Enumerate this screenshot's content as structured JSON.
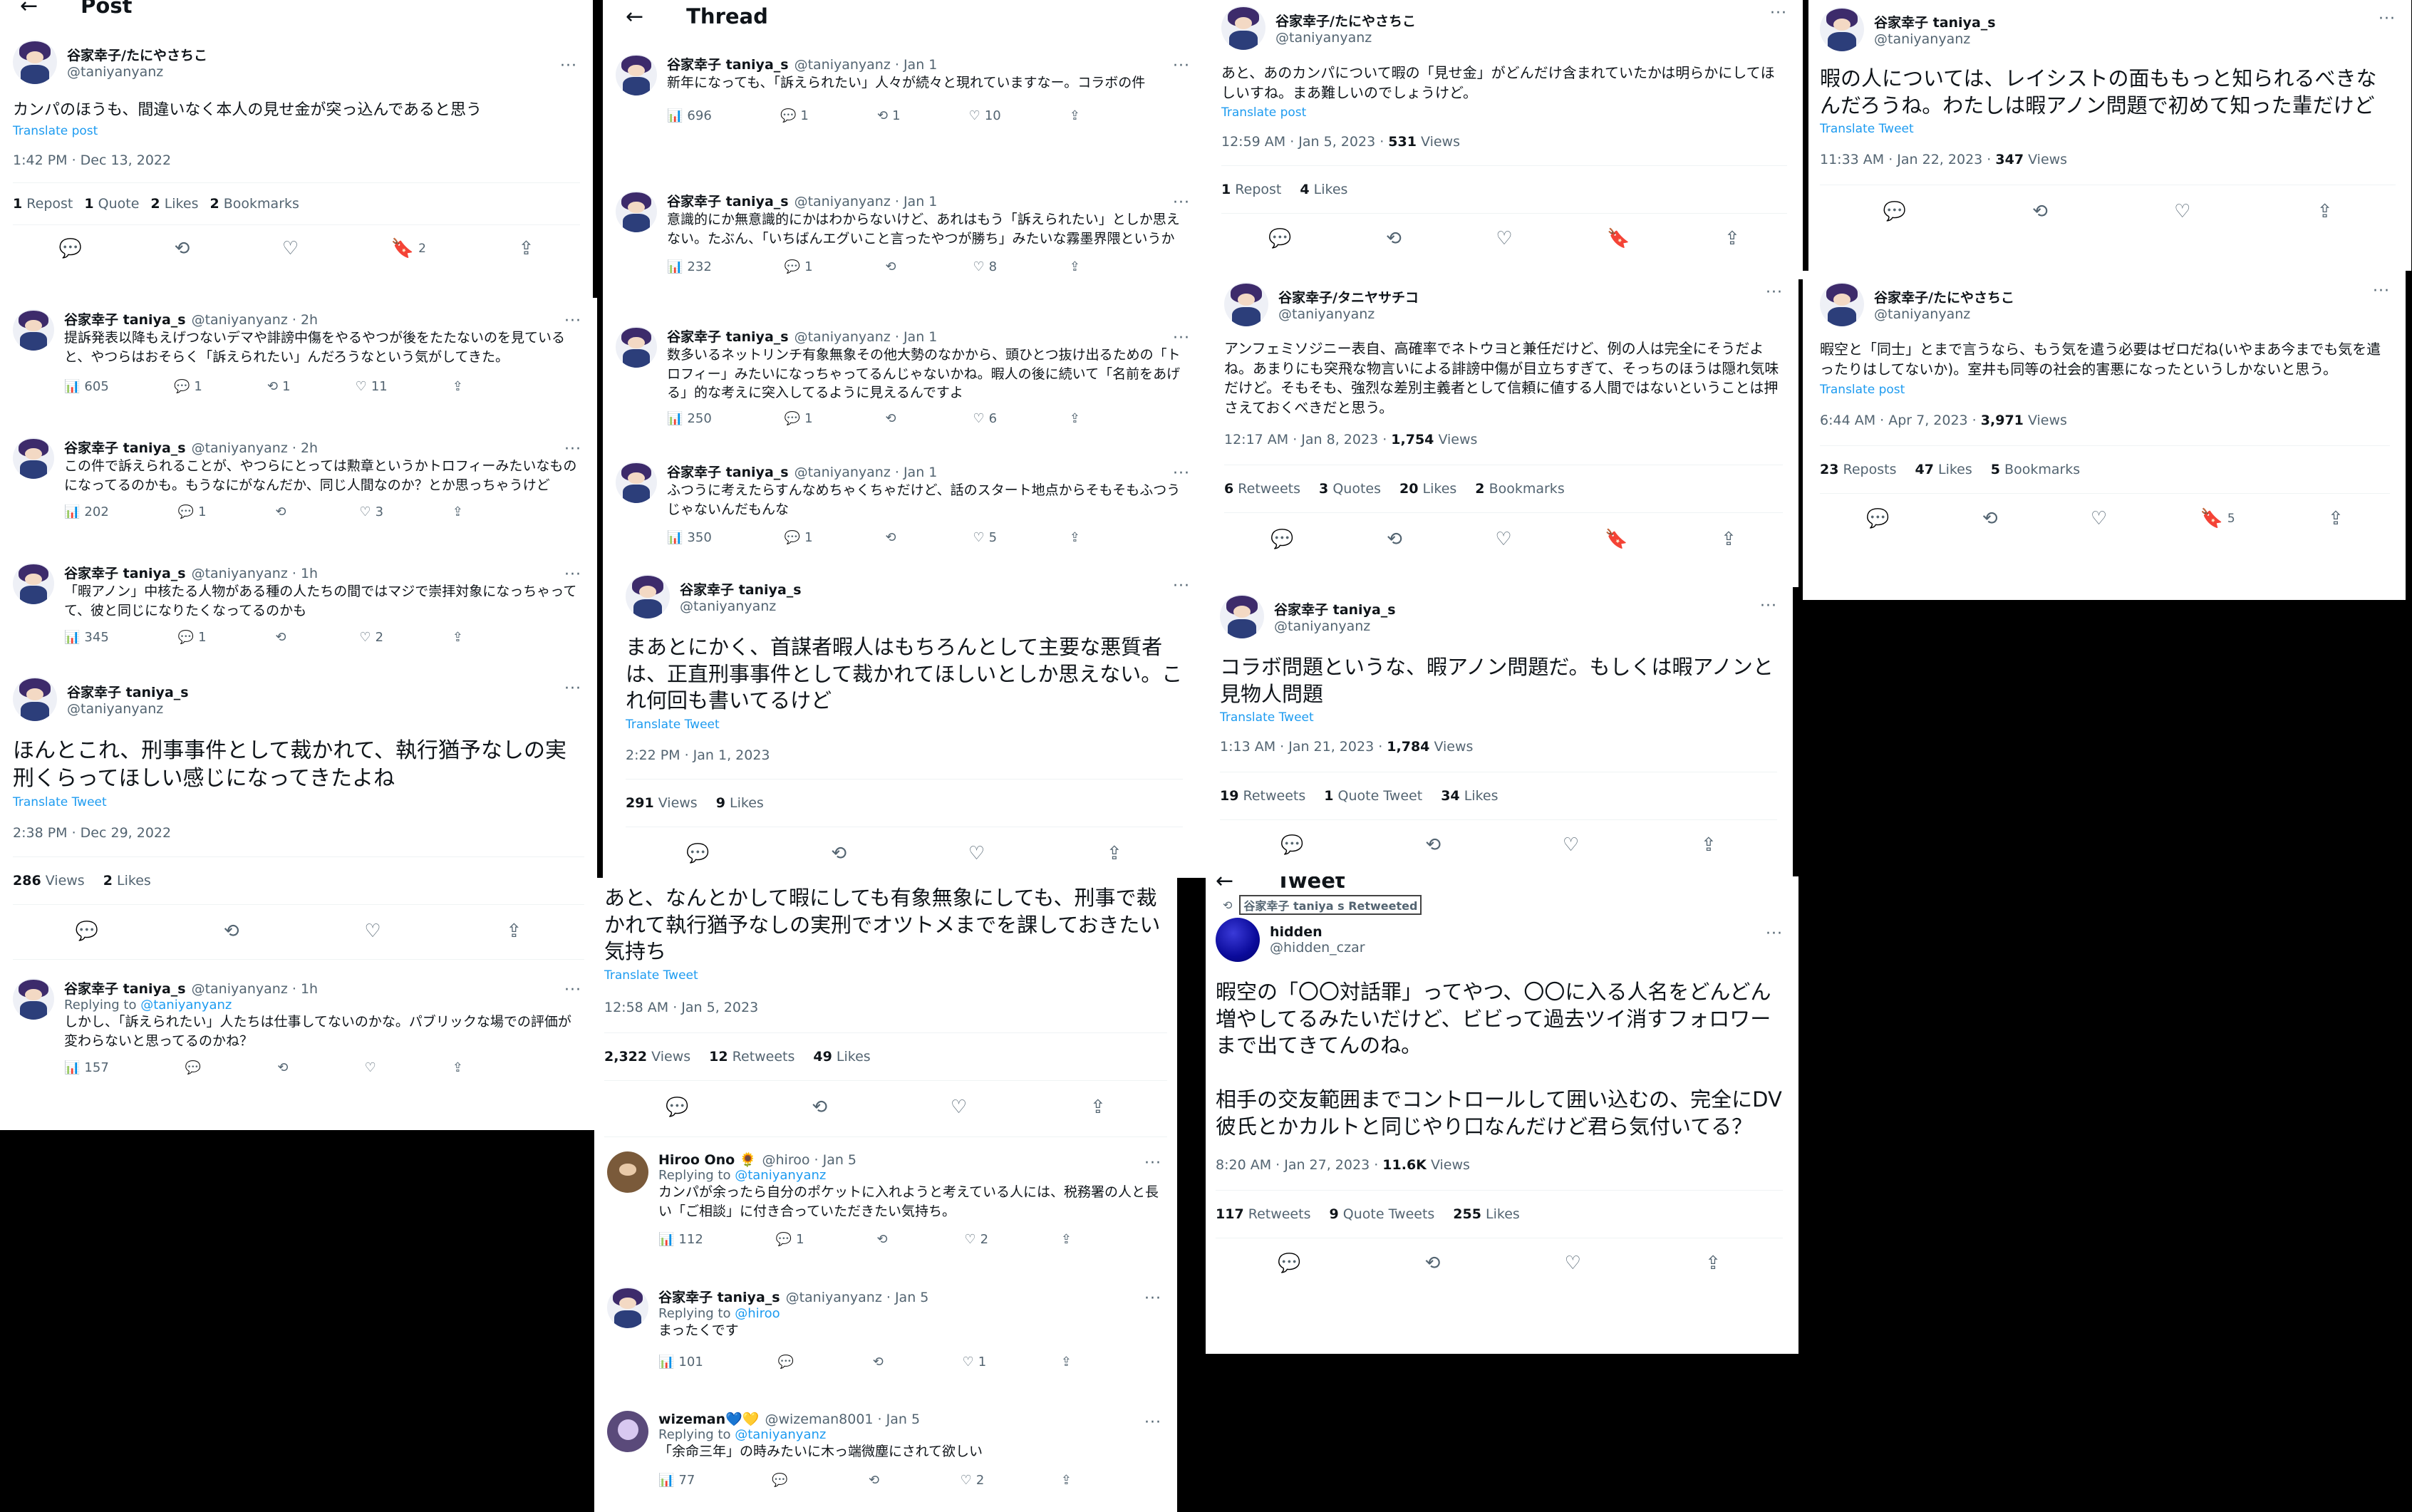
{
  "p1": {
    "title": "Post",
    "author_name": "谷家幸子/たにやさちこ",
    "author_handle": "@taniyanyanz",
    "text": "カンパのほうも、間違いなく本人の見せ金が突っ込んであると思う",
    "translate": "Translate post",
    "time": "1:42 PM · Dec 13, 2022",
    "reposts": "1",
    "reposts_label": "Repost",
    "quotes": "1",
    "quotes_label": "Quote",
    "likes": "2",
    "likes_label": "Likes",
    "bookmarks": "2",
    "bookmarks_label": "Bookmarks",
    "bookmark_count": "2"
  },
  "p2": {
    "replies": [
      {
        "name": "谷家幸子 taniya_s",
        "meta": "@taniyanyanz · 2h",
        "text": "提訴発表以降もえげつないデマや誹謗中傷をやるやつが後をたたないのを見ていると、やつらはおそらく「訴えられたい」んだろうなという気がしてきた。",
        "views": "605",
        "reply": "1",
        "rt": "1",
        "like": "11"
      },
      {
        "name": "谷家幸子 taniya_s",
        "meta": "@taniyanyanz · 2h",
        "text": "この件で訴えられることが、やつらにとっては勲章というかトロフィーみたいなものになってるのかも。もうなにがなんだか、同じ人間なのか？とか思っちゃうけど",
        "views": "202",
        "reply": "1",
        "rt": "",
        "like": "3"
      },
      {
        "name": "谷家幸子 taniya_s",
        "meta": "@taniyanyanz · 1h",
        "text": "「暇アノン」中核たる人物がある種の人たちの間ではマジで崇拝対象になっちゃってて、彼と同じになりたくなってるのかも",
        "views": "345",
        "reply": "1",
        "rt": "",
        "like": "2"
      }
    ],
    "main": {
      "name": "谷家幸子 taniya_s",
      "handle": "@taniyanyanz",
      "text": "ほんとこれ、刑事事件として裁かれて、執行猶予なしの実刑くらってほしい感じになってきたよね",
      "translate": "Translate Tweet",
      "time": "2:38 PM · Dec 29, 2022",
      "views": "286",
      "views_label": "Views",
      "likes": "2",
      "likes_label": "Likes"
    },
    "last": {
      "name": "谷家幸子 taniya_s",
      "meta": "@taniyanyanz · 1h",
      "replying_prefix": "Replying to",
      "replying_to": "@taniyanyanz",
      "text": "しかし、「訴えられたい」人たちは仕事してないのかな。パブリックな場での評価が変わらないと思ってるのかね？",
      "views": "157"
    }
  },
  "p3": {
    "title": "Thread",
    "tweets": [
      {
        "name": "谷家幸子 taniya_s",
        "meta": "@taniyanyanz · Jan 1",
        "text": "新年になっても、「訴えられたい」人々が続々と現れていますなー。コラボの件",
        "views": "696",
        "reply": "1",
        "rt": "1",
        "like": "10"
      },
      {
        "name": "谷家幸子 taniya_s",
        "meta": "@taniyanyanz · Jan 1",
        "text": "意識的にか無意識的にかはわからないけど、あれはもう「訴えられたい」としか思えない。たぶん、「いちばんエグいこと言ったやつが勝ち」みたいな霧墨界隈というか",
        "views": "232",
        "reply": "1",
        "rt": "",
        "like": "8"
      },
      {
        "name": "谷家幸子 taniya_s",
        "meta": "@taniyanyanz · Jan 1",
        "text": "数多いるネットリンチ有象無象その他大勢のなかから、頭ひとつ抜け出るための「トロフィー」みたいになっちゃってるんじゃないかね。暇人の後に続いて「名前をあげる」的な考えに突入してるように見えるんですよ",
        "views": "250",
        "reply": "1",
        "rt": "",
        "like": "6"
      },
      {
        "name": "谷家幸子 taniya_s",
        "meta": "@taniyanyanz · Jan 1",
        "text": "ふつうに考えたらすんなめちゃくちゃだけど、話のスタート地点からそもそもふつうじゃないんだもんな",
        "views": "350",
        "reply": "1",
        "rt": "",
        "like": "5"
      }
    ],
    "main": {
      "name": "谷家幸子 taniya_s",
      "handle": "@taniyanyanz",
      "text": "まあとにかく、首謀者暇人はもちろんとして主要な悪質者は、正直刑事事件として裁かれてほしいとしか思えない。これ何回も書いてるけど",
      "translate": "Translate Tweet",
      "time": "2:22 PM · Jan 1, 2023",
      "views": "291",
      "views_label": "Views",
      "likes": "9",
      "likes_label": "Likes"
    }
  },
  "p4": {
    "text": "あと、なんとかして暇にしても有象無象にしても、刑事で裁かれて執行猶予なしの実刑でオツトメまでを課しておきたい気持ち",
    "translate": "Translate Tweet",
    "time": "12:58 AM · Jan 5, 2023",
    "views": "2,322",
    "views_label": "Views",
    "retweets": "12",
    "retweets_label": "Retweets",
    "likes": "49",
    "likes_label": "Likes",
    "replies": [
      {
        "name": "Hiroo Ono 🌻",
        "meta": "@hiroo · Jan 5",
        "replying_prefix": "Replying to",
        "replying_to": "@taniyanyanz",
        "text": "カンパが余ったら自分のポケットに入れようと考えている人には、税務署の人と長い「ご相談」に付き合っていただきたい気持ち。",
        "views": "112",
        "reply": "1",
        "rt": "",
        "like": "2",
        "avatar": "hiroo"
      },
      {
        "name": "谷家幸子 taniya_s",
        "meta": "@taniyanyanz · Jan 5",
        "replying_prefix": "Replying to",
        "replying_to": "@hiroo",
        "text": "まったくです",
        "views": "101",
        "reply": "",
        "rt": "",
        "like": "1",
        "avatar": "taniya"
      },
      {
        "name": "wizeman💙💛",
        "meta": "@wizeman8001 · Jan 5",
        "replying_prefix": "Replying to",
        "replying_to": "@taniyanyanz",
        "text": "「余命三年」の時みたいに木っ端微塵にされて欲しい",
        "views": "77",
        "reply": "",
        "rt": "",
        "like": "2",
        "avatar": "wize"
      }
    ]
  },
  "p5": {
    "name": "谷家幸子/たにやさちこ",
    "handle": "@taniyanyanz",
    "text": "あと、あのカンパについて暇の「見せ金」がどんだけ含まれていたかは明らかにしてほしいすね。まあ難しいのでしょうけど。",
    "translate": "Translate post",
    "time": "12:59 AM · Jan 5, 2023 ·",
    "views": "531",
    "views_label": "Views",
    "reposts": "1",
    "reposts_label": "Repost",
    "likes": "4",
    "likes_label": "Likes"
  },
  "p6": {
    "name": "谷家幸子/タニヤサチコ",
    "handle": "@taniyanyanz",
    "text": "アンフェミソジニー表自、高確率でネトウヨと兼任だけど、例の人は完全にそうだよね。あまりにも突飛な物言いによる誹謗中傷が目立ちすぎて、そっちのほうは隠れ気味だけど。そもそも、強烈な差別主義者として信頼に値する人間ではないということは押さえておくべきだと思う。",
    "time": "12:17 AM · Jan 8, 2023 ·",
    "views": "1,754",
    "views_label": "Views",
    "retweets": "6",
    "retweets_label": "Retweets",
    "quotes": "3",
    "quotes_label": "Quotes",
    "likes": "20",
    "likes_label": "Likes",
    "bookmarks": "2",
    "bookmarks_label": "Bookmarks"
  },
  "p7": {
    "name": "谷家幸子 taniya_s",
    "handle": "@taniyanyanz",
    "text": "コラボ問題というな、暇アノン問題だ。もしくは暇アノンと見物人問題",
    "translate": "Translate Tweet",
    "time": "1:13 AM · Jan 21, 2023 ·",
    "views": "1,784",
    "views_label": "Views",
    "retweets": "19",
    "retweets_label": "Retweets",
    "quotes": "1",
    "quotes_label": "Quote Tweet",
    "likes": "34",
    "likes_label": "Likes"
  },
  "p8": {
    "title": "Tweet",
    "retweeted_by": "谷家幸子 taniya s Retweeted",
    "name": "hidden",
    "handle": "@hidden_czar",
    "text1": "暇空の「〇〇対話罪」ってやつ、〇〇に入る人名をどんどん増やしてるみたいだけど、ビビって過去ツイ消すフォロワーまで出てきてんのね。",
    "text2": "相手の交友範囲までコントロールして囲い込むの、完全にDV彼氏とかカルトと同じやり口なんだけど君ら気付いてる？",
    "time": "8:20 AM · Jan 27, 2023 ·",
    "views": "11.6K",
    "views_label": "Views",
    "retweets": "117",
    "retweets_label": "Retweets",
    "quotes": "9",
    "quotes_label": "Quote Tweets",
    "likes": "255",
    "likes_label": "Likes"
  },
  "p9": {
    "name": "谷家幸子 taniya_s",
    "handle": "@taniyanyanz",
    "text": "暇の人については、レイシストの面ももっと知られるべきなんだろうね。わたしは暇アノン問題で初めて知った輩だけど",
    "translate": "Translate Tweet",
    "time": "11:33 AM · Jan 22, 2023 ·",
    "views": "347",
    "views_label": "Views"
  },
  "p10": {
    "name": "谷家幸子/たにやさちこ",
    "handle": "@taniyanyanz",
    "text": "暇空と「同士」とまで言うなら、もう気を遣う必要はゼロだね(いやまあ今までも気を遣ったりはしてないか)。室井も同等の社会的害悪になったというしかないと思う。",
    "translate": "Translate post",
    "time": "6:44 AM · Apr 7, 2023 ·",
    "views": "3,971",
    "views_label": "Views",
    "reposts": "23",
    "reposts_label": "Reposts",
    "likes": "47",
    "likes_label": "Likes",
    "bookmarks": "5",
    "bookmarks_label": "Bookmarks",
    "bookmark_count": "5"
  }
}
